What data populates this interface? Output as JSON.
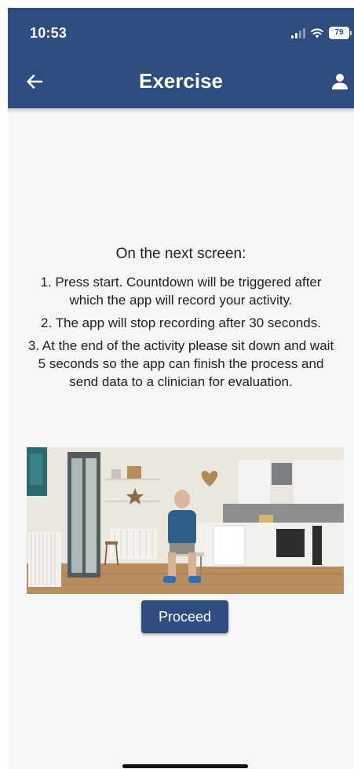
{
  "status_bar": {
    "time": "10:53",
    "battery": "79"
  },
  "header": {
    "title": "Exercise",
    "icons": {
      "back": "arrow-left-icon",
      "profile": "user-icon"
    }
  },
  "instructions": {
    "heading": "On the next screen:",
    "steps": [
      "1. Press start. Countdown will be triggered after which the app will record your activity.",
      "2. The app will stop recording after 30 seconds.",
      "3. At the end of the activity please sit down and wait 5 seconds so the app can finish the process and send data to a clinician for evaluation."
    ]
  },
  "actions": {
    "proceed_label": "Proceed"
  },
  "colors": {
    "primary": "#2f4c7e",
    "background": "#f7f7f8",
    "text": "#1f1f1f"
  }
}
